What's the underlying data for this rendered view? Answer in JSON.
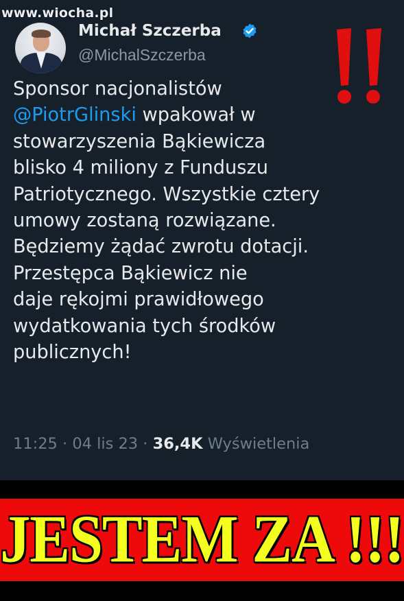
{
  "watermark": "www.wiocha.pl",
  "author": {
    "name": "Michał Szczerba",
    "handle": "@MichalSzczerba"
  },
  "tweet": {
    "lines": [
      {
        "text": "Sponsor nacjonalistów"
      },
      {
        "mention": "@PiotrGlinski",
        "text": " wpakował w"
      },
      {
        "text": "stowarzyszenia Bąkiewicza"
      },
      {
        "text": "blisko 4 miliony z Funduszu"
      },
      {
        "text": "Patriotycznego. Wszystkie cztery"
      },
      {
        "text": "umowy zostaną rozwiązane."
      },
      {
        "text": "Będziemy żądać zwrotu dotacji."
      },
      {
        "text": "Przestępca Bąkiewicz nie"
      },
      {
        "text": "daje rękojmi prawidłowego"
      },
      {
        "text": "wydatkowania tych środków"
      },
      {
        "text": "publicznych!"
      }
    ],
    "time": "11:25",
    "separator": "·",
    "date": "04 lis 23",
    "views_count": "36,4K",
    "views_label": "Wyświetlenia"
  },
  "banner": {
    "text": "JESTEM  ZA !!!"
  },
  "colors": {
    "background": "#15202b",
    "mention": "#1d9bf0",
    "verified": "#1d9bf0",
    "banner_bg": "#ee0a0a",
    "banner_text": "#f4ff20",
    "exclamation": "#e01010"
  },
  "icons": [
    "verified-badge-icon",
    "exclamation-marks-icon"
  ]
}
